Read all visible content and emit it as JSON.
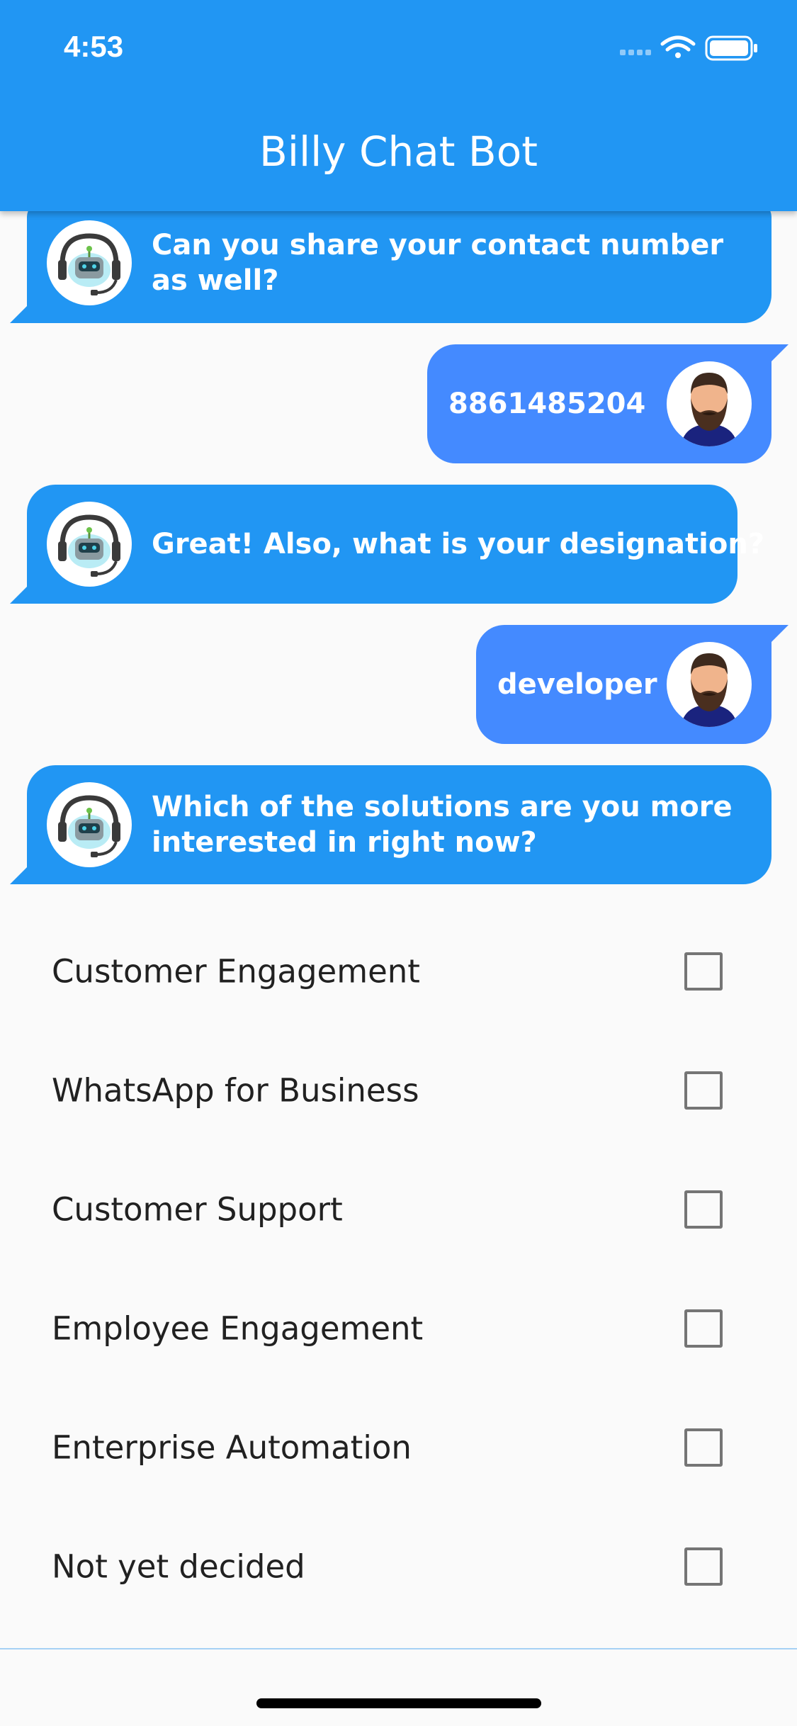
{
  "status_bar": {
    "time": "4:53"
  },
  "app_bar": {
    "title": "Billy Chat Bot"
  },
  "messages": [
    {
      "sender": "bot",
      "text": "Can you share your contact number as well?"
    },
    {
      "sender": "user",
      "text": "8861485204"
    },
    {
      "sender": "bot",
      "text": "Great! Also, what is your designation?"
    },
    {
      "sender": "user",
      "text": "developer"
    },
    {
      "sender": "bot",
      "text": "Which of the solutions are you more interested in right now?"
    }
  ],
  "options": [
    {
      "label": "Customer Engagement",
      "checked": false
    },
    {
      "label": "WhatsApp for Business",
      "checked": false
    },
    {
      "label": "Customer Support",
      "checked": false
    },
    {
      "label": "Employee Engagement",
      "checked": false
    },
    {
      "label": "Enterprise Automation",
      "checked": false
    },
    {
      "label": "Not yet decided",
      "checked": false
    }
  ],
  "colors": {
    "app_bar": "#2196f3",
    "bot_bubble": "#2196f3",
    "user_bubble": "#448aff",
    "background": "#fafafa"
  }
}
